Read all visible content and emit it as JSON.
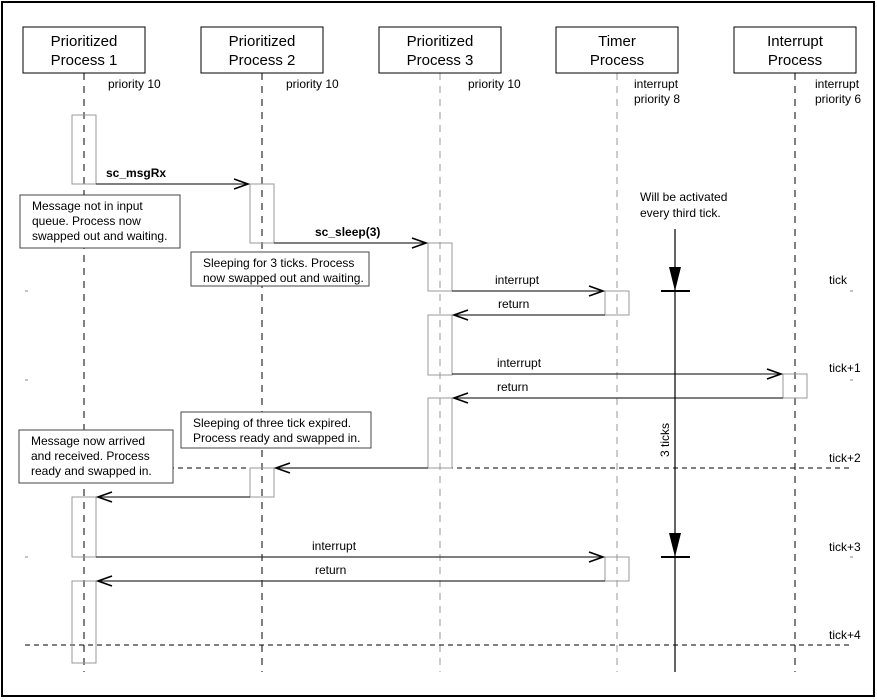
{
  "lifelines": [
    {
      "title": [
        "Prioritized",
        "Process 1"
      ],
      "priority": [
        "priority 10"
      ]
    },
    {
      "title": [
        "Prioritized",
        "Process 2"
      ],
      "priority": [
        "priority 10"
      ]
    },
    {
      "title": [
        "Prioritized",
        "Process 3"
      ],
      "priority": [
        "priority 10"
      ]
    },
    {
      "title": [
        "Timer",
        "Process"
      ],
      "priority": [
        "interrupt",
        "priority 8"
      ]
    },
    {
      "title": [
        "Interrupt",
        "Process"
      ],
      "priority": [
        "interrupt",
        "priority 6"
      ]
    }
  ],
  "messages": [
    {
      "label": "sc_msgRx",
      "from": 1,
      "to": 2,
      "bold": true
    },
    {
      "label": "sc_sleep(3)",
      "from": 2,
      "to": 3,
      "bold": true
    },
    {
      "label": "interrupt",
      "from": 3,
      "to": 4
    },
    {
      "label": "return",
      "from": 4,
      "to": 3
    },
    {
      "label": "interrupt",
      "from": 3,
      "to": 5
    },
    {
      "label": "return",
      "from": 5,
      "to": 3
    },
    {
      "label": "",
      "from": 3,
      "to": 2
    },
    {
      "label": "",
      "from": 2,
      "to": 1
    },
    {
      "label": "interrupt",
      "from": 1,
      "to": 4
    },
    {
      "label": "return",
      "from": 4,
      "to": 1
    }
  ],
  "notes": [
    {
      "lines": [
        "Message not in input",
        "queue. Process now",
        "swapped out and waiting."
      ]
    },
    {
      "lines": [
        "Sleeping for 3 ticks. Process",
        "now swapped out and waiting."
      ]
    },
    {
      "lines": [
        "Sleeping of three tick expired.",
        "Process ready and swapped in."
      ]
    },
    {
      "lines": [
        "Message now arrived",
        "and received. Process",
        "ready and swapped in."
      ]
    }
  ],
  "timer_note": [
    "Will be activated",
    "every third tick."
  ],
  "timer_period_label": "3 ticks",
  "ticks": [
    "tick",
    "tick+1",
    "tick+2",
    "tick+3",
    "tick+4"
  ]
}
